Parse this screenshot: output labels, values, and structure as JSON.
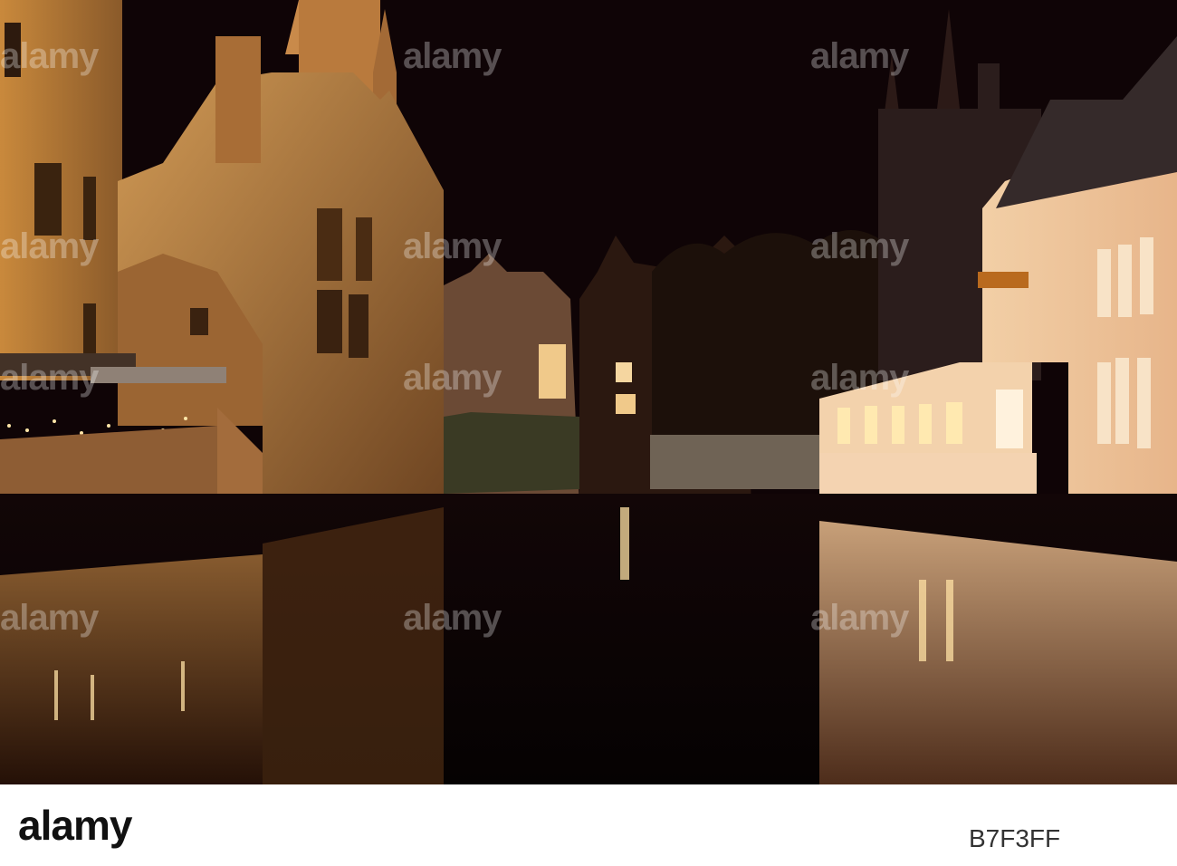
{
  "photo": {
    "subject": "Canal at night with illuminated brick buildings and reflections",
    "watermark_text": "alamy"
  },
  "footer": {
    "logo_text": "alamy",
    "image_id": "B7F3FF"
  }
}
